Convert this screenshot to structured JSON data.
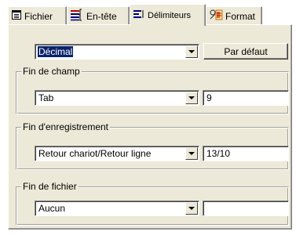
{
  "tabs": [
    {
      "label": "Fichier",
      "icon": "file-icon",
      "active": false
    },
    {
      "label": "En-tête",
      "icon": "header-icon",
      "active": false
    },
    {
      "label": "Délimiteurs",
      "icon": "delimiters-icon",
      "active": true
    },
    {
      "label": "Format",
      "icon": "format-icon",
      "active": false
    }
  ],
  "top": {
    "type_value": "Décimal",
    "default_button": "Par défaut"
  },
  "field_end": {
    "label": "Fin de champ",
    "combo_value": "Tab",
    "code_value": "9"
  },
  "record_end": {
    "label": "Fin d'enregistrement",
    "combo_value": "Retour chariot/Retour ligne",
    "code_value": "13/10"
  },
  "file_end": {
    "label": "Fin de fichier",
    "combo_value": "Aucun",
    "code_value": ""
  },
  "colors": {
    "face": "#ece9d8",
    "selection": "#0a246a"
  }
}
